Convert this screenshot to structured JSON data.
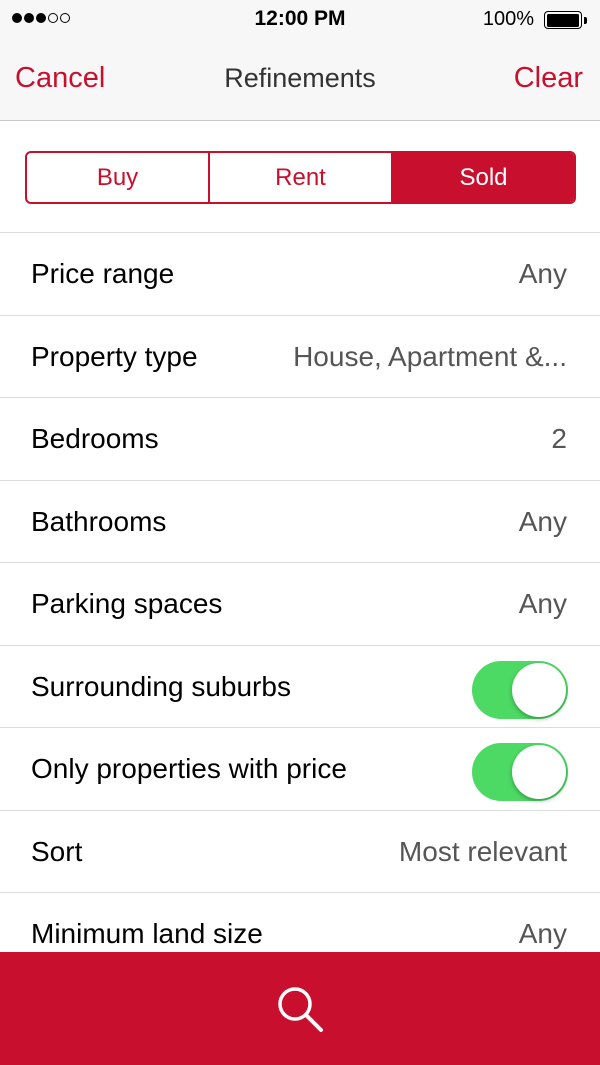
{
  "status_bar": {
    "time": "12:00 PM",
    "battery": "100%",
    "signal_icon": "signal-dots-icon",
    "battery_icon": "battery-icon"
  },
  "nav": {
    "cancel": "Cancel",
    "title": "Refinements",
    "clear": "Clear"
  },
  "segments": {
    "buy": "Buy",
    "rent": "Rent",
    "sold": "Sold",
    "selected": "Sold"
  },
  "rows": {
    "price_range": {
      "label": "Price range",
      "value": "Any"
    },
    "property_type": {
      "label": "Property type",
      "value": "House, Apartment &..."
    },
    "bedrooms": {
      "label": "Bedrooms",
      "value": "2"
    },
    "bathrooms": {
      "label": "Bathrooms",
      "value": "Any"
    },
    "parking_spaces": {
      "label": "Parking spaces",
      "value": "Any"
    },
    "surrounding_suburbs": {
      "label": "Surrounding suburbs",
      "toggle_on": true
    },
    "only_with_price": {
      "label": "Only properties with price",
      "toggle_on": true
    },
    "sort": {
      "label": "Sort",
      "value": "Most relevant"
    },
    "min_land_size": {
      "label": "Minimum land size",
      "value": "Any"
    }
  },
  "search_button": {
    "icon": "search-icon"
  },
  "colors": {
    "accent": "#c8102e",
    "toggle_on": "#4cd964"
  }
}
